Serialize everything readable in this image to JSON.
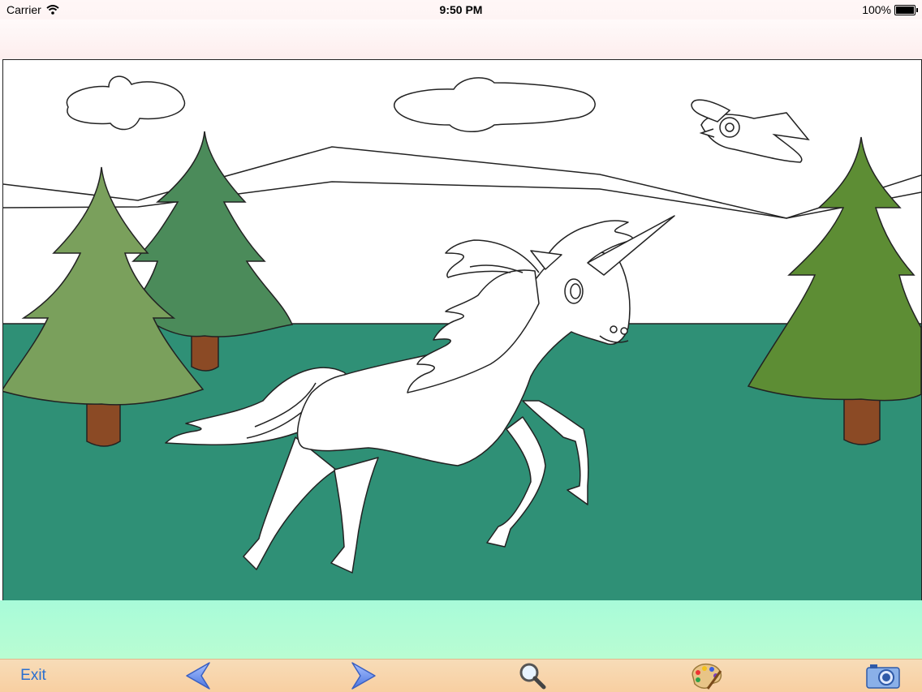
{
  "status_bar": {
    "carrier": "Carrier",
    "time": "9:50 PM",
    "battery": "100%",
    "battery_level": 1.0
  },
  "toolbar": {
    "exit_label": "Exit",
    "buttons": [
      {
        "name": "previous-arrow-icon"
      },
      {
        "name": "next-arrow-icon"
      },
      {
        "name": "magnifier-icon"
      },
      {
        "name": "palette-icon"
      },
      {
        "name": "camera-icon"
      }
    ]
  },
  "colors": {
    "grass": "#2f9076",
    "tree_light": "#7aa05c",
    "tree_mid": "#4b8b5a",
    "tree_right": "#5d8d34",
    "trunk": "#8b4a25",
    "ground_band": "#aefad6",
    "toolbar": "#f8d3a6",
    "link_blue": "#2a6fd0"
  }
}
